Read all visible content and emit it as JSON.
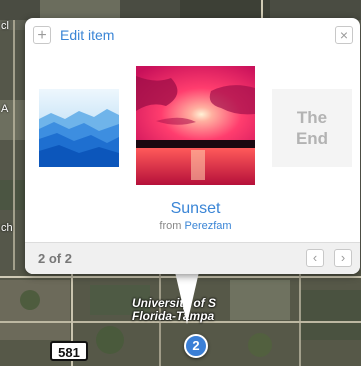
{
  "map": {
    "location_label": "University of S\nFlorida-Tampa",
    "route_shield": "581",
    "cluster_count": "2",
    "edge_letter_left": "A",
    "edge_letter_ch": "ch",
    "edge_letter_cl": "cl"
  },
  "popup": {
    "add_icon": "+",
    "edit_label": "Edit item",
    "close_icon": "×",
    "end_card_text": "The\nEnd",
    "item_title": "Sunset",
    "source_prefix": "from",
    "source_author": "Perezfam",
    "page_indicator": "2 of 2",
    "prev_icon": "‹",
    "next_icon": "›"
  },
  "colors": {
    "link": "#3a85d6",
    "marker": "#3a7fd6"
  }
}
